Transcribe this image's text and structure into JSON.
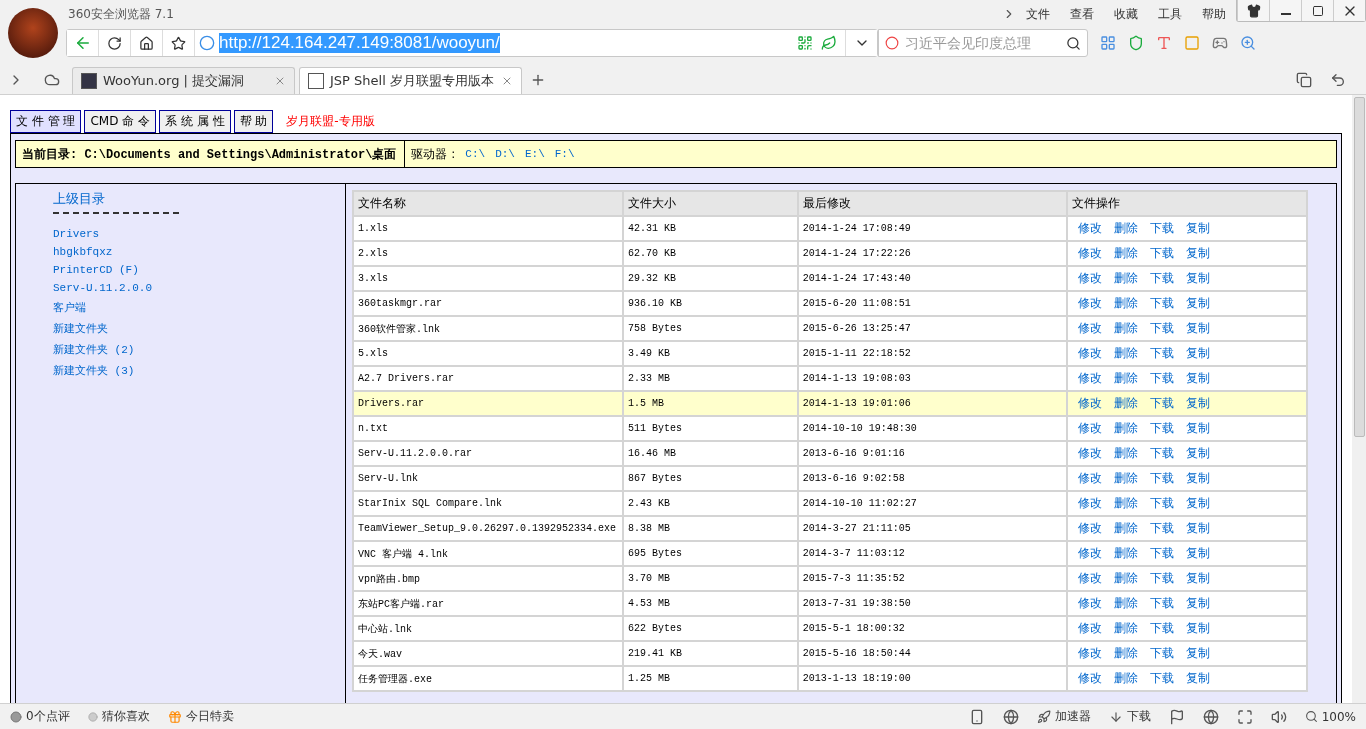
{
  "window": {
    "title": "360安全浏览器 7.1"
  },
  "menu": [
    "文件",
    "查看",
    "收藏",
    "工具",
    "帮助"
  ],
  "address_bar": {
    "url": "http://124.164.247.149:8081/wooyun/",
    "search_placeholder": "习近平会见印度总理"
  },
  "tabs": [
    {
      "label": "WooYun.org | 提交漏洞",
      "selected": false
    },
    {
      "label": "JSP Shell 岁月联盟专用版本",
      "selected": true
    }
  ],
  "page": {
    "nav": [
      {
        "label": "文 件 管 理",
        "selected": true
      },
      {
        "label": "CMD 命 令",
        "selected": false
      },
      {
        "label": "系 统 属 性",
        "selected": false
      },
      {
        "label": "帮 助",
        "selected": false
      }
    ],
    "brand": "岁月联盟-专用版",
    "path_label": "当前目录:",
    "path": "C:\\Documents and Settings\\Administrator\\桌面",
    "drives_label": "驱动器 :",
    "drives": [
      "C:\\",
      "D:\\",
      "E:\\",
      "F:\\"
    ],
    "sidebar": {
      "parent": "上级目录",
      "folders": [
        "Drivers",
        "hbgkbfqxz",
        "PrinterCD (F)",
        "Serv-U.11.2.0.0",
        "客户端",
        "新建文件夹",
        "新建文件夹 (2)",
        "新建文件夹 (3)"
      ]
    },
    "table": {
      "columns": [
        "文件名称",
        "文件大小",
        "最后修改",
        "文件操作"
      ],
      "rows": [
        {
          "name": "1.xls",
          "size": "42.31 KB",
          "modified": "2014-1-24 17:08:49",
          "selected": false,
          "actions": [
            "修改",
            "删除",
            "下载",
            "复制"
          ]
        },
        {
          "name": "2.xls",
          "size": "62.70 KB",
          "modified": "2014-1-24 17:22:26",
          "selected": false,
          "actions": [
            "修改",
            "删除",
            "下载",
            "复制"
          ]
        },
        {
          "name": "3.xls",
          "size": "29.32 KB",
          "modified": "2014-1-24 17:43:40",
          "selected": false,
          "actions": [
            "修改",
            "删除",
            "下载",
            "复制"
          ]
        },
        {
          "name": "360taskmgr.rar",
          "size": "936.10 KB",
          "modified": "2015-6-20 11:08:51",
          "selected": false,
          "actions": [
            "修改",
            "删除",
            "下载",
            "复制"
          ]
        },
        {
          "name": "360软件管家.lnk",
          "size": "758 Bytes",
          "modified": "2015-6-26 13:25:47",
          "selected": false,
          "actions": [
            "修改",
            "删除",
            "下载",
            "复制"
          ]
        },
        {
          "name": "5.xls",
          "size": "3.49 KB",
          "modified": "2015-1-11 22:18:52",
          "selected": false,
          "actions": [
            "修改",
            "删除",
            "下载",
            "复制"
          ]
        },
        {
          "name": "A2.7 Drivers.rar",
          "size": "2.33 MB",
          "modified": "2014-1-13 19:08:03",
          "selected": false,
          "actions": [
            "修改",
            "删除",
            "下载",
            "复制"
          ]
        },
        {
          "name": "Drivers.rar",
          "size": "1.5 MB",
          "modified": "2014-1-13 19:01:06",
          "selected": true,
          "actions": [
            "修改",
            "删除",
            "下载",
            "复制"
          ]
        },
        {
          "name": "n.txt",
          "size": "511 Bytes",
          "modified": "2014-10-10 19:48:30",
          "selected": false,
          "actions": [
            "修改",
            "删除",
            "下载",
            "复制"
          ]
        },
        {
          "name": "Serv-U.11.2.0.0.rar",
          "size": "16.46 MB",
          "modified": "2013-6-16 9:01:16",
          "selected": false,
          "actions": [
            "修改",
            "删除",
            "下载",
            "复制"
          ]
        },
        {
          "name": "Serv-U.lnk",
          "size": "867 Bytes",
          "modified": "2013-6-16 9:02:58",
          "selected": false,
          "actions": [
            "修改",
            "删除",
            "下载",
            "复制"
          ]
        },
        {
          "name": "StarInix SQL Compare.lnk",
          "size": "2.43 KB",
          "modified": "2014-10-10 11:02:27",
          "selected": false,
          "actions": [
            "修改",
            "删除",
            "下载",
            "复制"
          ]
        },
        {
          "name": "TeamViewer_Setup_9.0.26297.0.1392952334.exe",
          "size": "8.38 MB",
          "modified": "2014-3-27 21:11:05",
          "selected": false,
          "actions": [
            "修改",
            "删除",
            "下载",
            "复制"
          ]
        },
        {
          "name": "VNC 客户端 4.lnk",
          "size": "695 Bytes",
          "modified": "2014-3-7 11:03:12",
          "selected": false,
          "actions": [
            "修改",
            "删除",
            "下载",
            "复制"
          ]
        },
        {
          "name": "vpn路由.bmp",
          "size": "3.70 MB",
          "modified": "2015-7-3 11:35:52",
          "selected": false,
          "actions": [
            "修改",
            "删除",
            "下载",
            "复制"
          ]
        },
        {
          "name": "东站PC客户端.rar",
          "size": "4.53 MB",
          "modified": "2013-7-31 19:38:50",
          "selected": false,
          "actions": [
            "修改",
            "删除",
            "下载",
            "复制"
          ]
        },
        {
          "name": "中心站.lnk",
          "size": "622 Bytes",
          "modified": "2015-5-1 18:00:32",
          "selected": false,
          "actions": [
            "修改",
            "删除",
            "下载",
            "复制"
          ]
        },
        {
          "name": "今天.wav",
          "size": "219.41 KB",
          "modified": "2015-5-16 18:50:44",
          "selected": false,
          "actions": [
            "修改",
            "删除",
            "下载",
            "复制"
          ]
        },
        {
          "name": "任务管理器.exe",
          "size": "1.25 MB",
          "modified": "2013-1-13 18:19:00",
          "selected": false,
          "actions": [
            "修改",
            "删除",
            "下载",
            "复制"
          ]
        }
      ]
    }
  },
  "status_bar": {
    "left": [
      "0个点评",
      "猜你喜欢",
      "今日特卖"
    ],
    "accelerator": "加速器",
    "download": "下载",
    "zoom": "100%"
  }
}
